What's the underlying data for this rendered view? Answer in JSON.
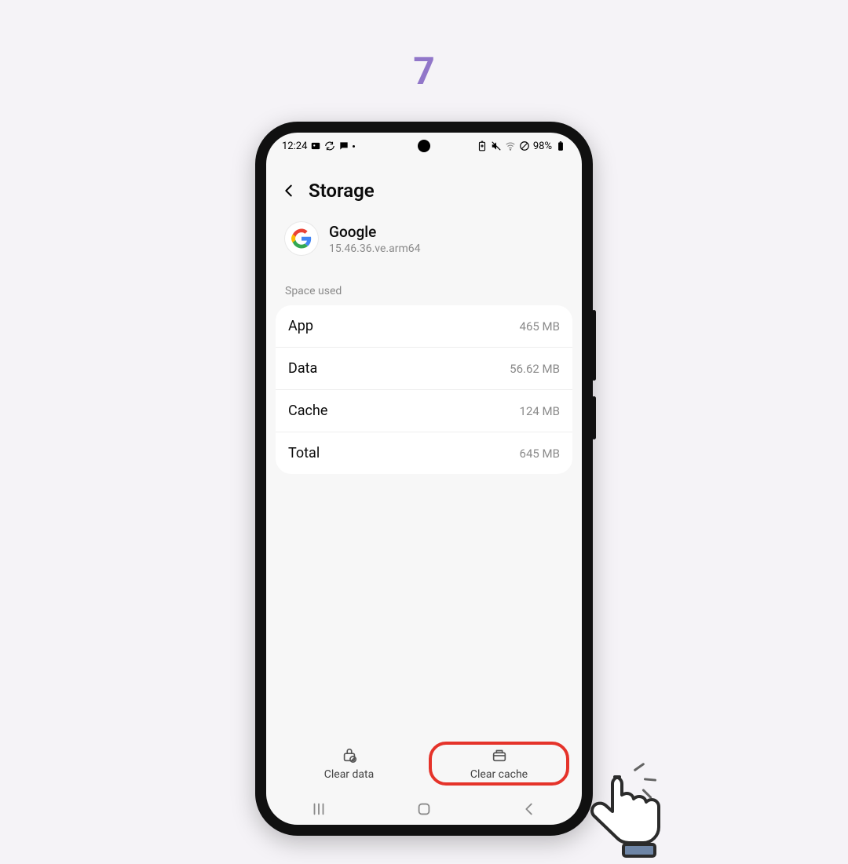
{
  "step_number": "7",
  "status_bar": {
    "time": "12:24",
    "battery_text": "98%"
  },
  "header": {
    "title": "Storage"
  },
  "app_info": {
    "name": "Google",
    "version": "15.46.36.ve.arm64"
  },
  "section_label": "Space used",
  "rows": [
    {
      "label": "App",
      "value": "465 MB"
    },
    {
      "label": "Data",
      "value": "56.62 MB"
    },
    {
      "label": "Cache",
      "value": "124 MB"
    },
    {
      "label": "Total",
      "value": "645 MB"
    }
  ],
  "actions": {
    "clear_data": "Clear data",
    "clear_cache": "Clear cache"
  }
}
